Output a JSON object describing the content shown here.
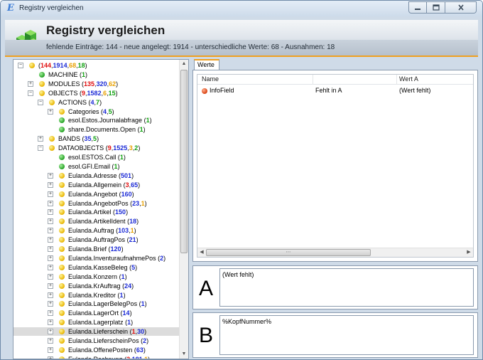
{
  "window": {
    "title": "Registry vergleichen",
    "app_icon": "E"
  },
  "header": {
    "title": "Registry vergleichen",
    "subtitle": "fehlende Einträge: 144 - neue angelegt: 1914 - unterschiedliche Werte: 68 - Ausnahmen: 18"
  },
  "tree": {
    "rows": [
      {
        "indent": 0,
        "exp": "minus",
        "dot": "yellow",
        "name": "",
        "counts": [
          [
            "(",
            ""
          ],
          [
            "144",
            "red"
          ],
          [
            ",",
            ""
          ],
          [
            "1914",
            "blue"
          ],
          [
            ",",
            ""
          ],
          [
            "68",
            "orange"
          ],
          [
            ",",
            ""
          ],
          [
            "18",
            "green"
          ],
          [
            ")",
            ""
          ]
        ]
      },
      {
        "indent": 1,
        "exp": "",
        "dot": "green",
        "name": "MACHINE ",
        "counts": [
          [
            "(",
            ""
          ],
          [
            "1",
            "green"
          ],
          [
            ")",
            ""
          ]
        ]
      },
      {
        "indent": 1,
        "exp": "plus",
        "dot": "yellow",
        "name": "MODULES ",
        "counts": [
          [
            "(",
            ""
          ],
          [
            "135",
            "red"
          ],
          [
            ",",
            ""
          ],
          [
            "320",
            "blue"
          ],
          [
            ",",
            ""
          ],
          [
            "62",
            "orange"
          ],
          [
            ")",
            ""
          ]
        ]
      },
      {
        "indent": 1,
        "exp": "minus",
        "dot": "yellow",
        "name": "OBJECTS ",
        "counts": [
          [
            "(",
            ""
          ],
          [
            "9",
            "red"
          ],
          [
            ",",
            ""
          ],
          [
            "1582",
            "blue"
          ],
          [
            ",",
            ""
          ],
          [
            "6",
            "orange"
          ],
          [
            ",",
            ""
          ],
          [
            "15",
            "green"
          ],
          [
            ")",
            ""
          ]
        ]
      },
      {
        "indent": 2,
        "exp": "minus",
        "dot": "yellow",
        "name": "ACTIONS ",
        "counts": [
          [
            "(",
            ""
          ],
          [
            "4",
            "blue"
          ],
          [
            ",",
            ""
          ],
          [
            "7",
            "green"
          ],
          [
            ")",
            ""
          ]
        ]
      },
      {
        "indent": 3,
        "exp": "plus",
        "dot": "yellow",
        "name": "Categories ",
        "counts": [
          [
            "(",
            ""
          ],
          [
            "4",
            "blue"
          ],
          [
            ",",
            ""
          ],
          [
            "5",
            "green"
          ],
          [
            ")",
            ""
          ]
        ]
      },
      {
        "indent": 3,
        "exp": "",
        "dot": "green",
        "name": "esol.Estos.Journalabfrage ",
        "counts": [
          [
            "(",
            ""
          ],
          [
            "1",
            "green"
          ],
          [
            ")",
            ""
          ]
        ]
      },
      {
        "indent": 3,
        "exp": "",
        "dot": "green",
        "name": "share.Documents.Open ",
        "counts": [
          [
            "(",
            ""
          ],
          [
            "1",
            "green"
          ],
          [
            ")",
            ""
          ]
        ]
      },
      {
        "indent": 2,
        "exp": "plus",
        "dot": "yellow",
        "name": "BANDS ",
        "counts": [
          [
            "(",
            ""
          ],
          [
            "35",
            "blue"
          ],
          [
            ",",
            ""
          ],
          [
            "5",
            "green"
          ],
          [
            ")",
            ""
          ]
        ]
      },
      {
        "indent": 2,
        "exp": "minus",
        "dot": "yellow",
        "name": "DATAOBJECTS ",
        "counts": [
          [
            "(",
            ""
          ],
          [
            "9",
            "red"
          ],
          [
            ",",
            ""
          ],
          [
            "1525",
            "blue"
          ],
          [
            ",",
            ""
          ],
          [
            "3",
            "orange"
          ],
          [
            ",",
            ""
          ],
          [
            "2",
            "green"
          ],
          [
            ")",
            ""
          ]
        ]
      },
      {
        "indent": 3,
        "exp": "",
        "dot": "green",
        "name": "esol.ESTOS.Call ",
        "counts": [
          [
            "(",
            ""
          ],
          [
            "1",
            "green"
          ],
          [
            ")",
            ""
          ]
        ]
      },
      {
        "indent": 3,
        "exp": "",
        "dot": "green",
        "name": "esol.GFI.Email ",
        "counts": [
          [
            "(",
            ""
          ],
          [
            "1",
            "green"
          ],
          [
            ")",
            ""
          ]
        ]
      },
      {
        "indent": 3,
        "exp": "plus",
        "dot": "yellow",
        "name": "Eulanda.Adresse ",
        "counts": [
          [
            "(",
            ""
          ],
          [
            "501",
            "blue"
          ],
          [
            ")",
            ""
          ]
        ]
      },
      {
        "indent": 3,
        "exp": "plus",
        "dot": "yellow",
        "name": "Eulanda.Allgemein ",
        "counts": [
          [
            "(",
            ""
          ],
          [
            "3",
            "red"
          ],
          [
            ",",
            ""
          ],
          [
            "65",
            "blue"
          ],
          [
            ")",
            ""
          ]
        ]
      },
      {
        "indent": 3,
        "exp": "plus",
        "dot": "yellow",
        "name": "Eulanda.Angebot ",
        "counts": [
          [
            "(",
            ""
          ],
          [
            "160",
            "blue"
          ],
          [
            ")",
            ""
          ]
        ]
      },
      {
        "indent": 3,
        "exp": "plus",
        "dot": "yellow",
        "name": "Eulanda.AngebotPos ",
        "counts": [
          [
            "(",
            ""
          ],
          [
            "23",
            "blue"
          ],
          [
            ",",
            ""
          ],
          [
            "1",
            "orange"
          ],
          [
            ")",
            ""
          ]
        ]
      },
      {
        "indent": 3,
        "exp": "plus",
        "dot": "yellow",
        "name": "Eulanda.Artikel ",
        "counts": [
          [
            "(",
            ""
          ],
          [
            "150",
            "blue"
          ],
          [
            ")",
            ""
          ]
        ]
      },
      {
        "indent": 3,
        "exp": "plus",
        "dot": "yellow",
        "name": "Eulanda.ArtikelIdent ",
        "counts": [
          [
            "(",
            ""
          ],
          [
            "18",
            "blue"
          ],
          [
            ")",
            ""
          ]
        ]
      },
      {
        "indent": 3,
        "exp": "plus",
        "dot": "yellow",
        "name": "Eulanda.Auftrag ",
        "counts": [
          [
            "(",
            ""
          ],
          [
            "103",
            "blue"
          ],
          [
            ",",
            ""
          ],
          [
            "1",
            "orange"
          ],
          [
            ")",
            ""
          ]
        ]
      },
      {
        "indent": 3,
        "exp": "plus",
        "dot": "yellow",
        "name": "Eulanda.AuftragPos ",
        "counts": [
          [
            "(",
            ""
          ],
          [
            "21",
            "blue"
          ],
          [
            ")",
            ""
          ]
        ]
      },
      {
        "indent": 3,
        "exp": "plus",
        "dot": "yellow",
        "name": "Eulanda.Brief ",
        "counts": [
          [
            "(",
            ""
          ],
          [
            "120",
            "blue"
          ],
          [
            ")",
            ""
          ]
        ]
      },
      {
        "indent": 3,
        "exp": "plus",
        "dot": "yellow",
        "name": "Eulanda.InventuraufnahmePos ",
        "counts": [
          [
            "(",
            ""
          ],
          [
            "2",
            "blue"
          ],
          [
            ")",
            ""
          ]
        ]
      },
      {
        "indent": 3,
        "exp": "plus",
        "dot": "yellow",
        "name": "Eulanda.KasseBeleg ",
        "counts": [
          [
            "(",
            ""
          ],
          [
            "5",
            "blue"
          ],
          [
            ")",
            ""
          ]
        ]
      },
      {
        "indent": 3,
        "exp": "plus",
        "dot": "yellow",
        "name": "Eulanda.Konzern ",
        "counts": [
          [
            "(",
            ""
          ],
          [
            "1",
            "blue"
          ],
          [
            ")",
            ""
          ]
        ]
      },
      {
        "indent": 3,
        "exp": "plus",
        "dot": "yellow",
        "name": "Eulanda.KrAuftrag ",
        "counts": [
          [
            "(",
            ""
          ],
          [
            "24",
            "blue"
          ],
          [
            ")",
            ""
          ]
        ]
      },
      {
        "indent": 3,
        "exp": "plus",
        "dot": "yellow",
        "name": "Eulanda.Kreditor ",
        "counts": [
          [
            "(",
            ""
          ],
          [
            "1",
            "blue"
          ],
          [
            ")",
            ""
          ]
        ]
      },
      {
        "indent": 3,
        "exp": "plus",
        "dot": "yellow",
        "name": "Eulanda.LagerBelegPos ",
        "counts": [
          [
            "(",
            ""
          ],
          [
            "1",
            "blue"
          ],
          [
            ")",
            ""
          ]
        ]
      },
      {
        "indent": 3,
        "exp": "plus",
        "dot": "yellow",
        "name": "Eulanda.LagerOrt ",
        "counts": [
          [
            "(",
            ""
          ],
          [
            "14",
            "blue"
          ],
          [
            ")",
            ""
          ]
        ]
      },
      {
        "indent": 3,
        "exp": "plus",
        "dot": "yellow",
        "name": "Eulanda.Lagerplatz ",
        "counts": [
          [
            "(",
            ""
          ],
          [
            "1",
            "blue"
          ],
          [
            ")",
            ""
          ]
        ]
      },
      {
        "indent": 3,
        "exp": "plus",
        "dot": "yellow",
        "name": "Eulanda.Lieferschein ",
        "selected": true,
        "counts": [
          [
            "(",
            ""
          ],
          [
            "1",
            "red"
          ],
          [
            ",",
            ""
          ],
          [
            "30",
            "blue"
          ],
          [
            ")",
            ""
          ]
        ]
      },
      {
        "indent": 3,
        "exp": "plus",
        "dot": "yellow",
        "name": "Eulanda.LieferscheinPos ",
        "counts": [
          [
            "(",
            ""
          ],
          [
            "2",
            "blue"
          ],
          [
            ")",
            ""
          ]
        ]
      },
      {
        "indent": 3,
        "exp": "plus",
        "dot": "yellow",
        "name": "Eulanda.OffenePosten ",
        "counts": [
          [
            "(",
            ""
          ],
          [
            "63",
            "blue"
          ],
          [
            ")",
            ""
          ]
        ]
      },
      {
        "indent": 3,
        "exp": "plus",
        "dot": "yellow",
        "name": "Eulanda.Rechnung ",
        "counts": [
          [
            "(",
            ""
          ],
          [
            "3",
            "red"
          ],
          [
            ",",
            ""
          ],
          [
            "181",
            "blue"
          ],
          [
            ",",
            ""
          ],
          [
            "1",
            "orange"
          ],
          [
            ")",
            ""
          ]
        ]
      }
    ]
  },
  "values_tab": {
    "label": "Werte",
    "columns": [
      "Name",
      "",
      "Wert A"
    ],
    "rows": [
      {
        "status": "red",
        "name": "InfoField",
        "state": "Fehlt in A",
        "wert_a": "(Wert fehlt)"
      }
    ]
  },
  "detail": {
    "a_label": "A",
    "a_value": "(Wert fehlt)",
    "b_label": "B",
    "b_value": "%KopfNummer%"
  },
  "colors": {
    "accent": "#f0a020",
    "red": "#e01010",
    "blue": "#1c2bd6",
    "green": "#10a010",
    "orange": "#e8a000"
  },
  "icons": [
    "minimize-icon",
    "maximize-icon",
    "close-icon",
    "registry-cubes-icon",
    "expand-plus-icon",
    "collapse-minus-icon",
    "status-dot-icon"
  ]
}
